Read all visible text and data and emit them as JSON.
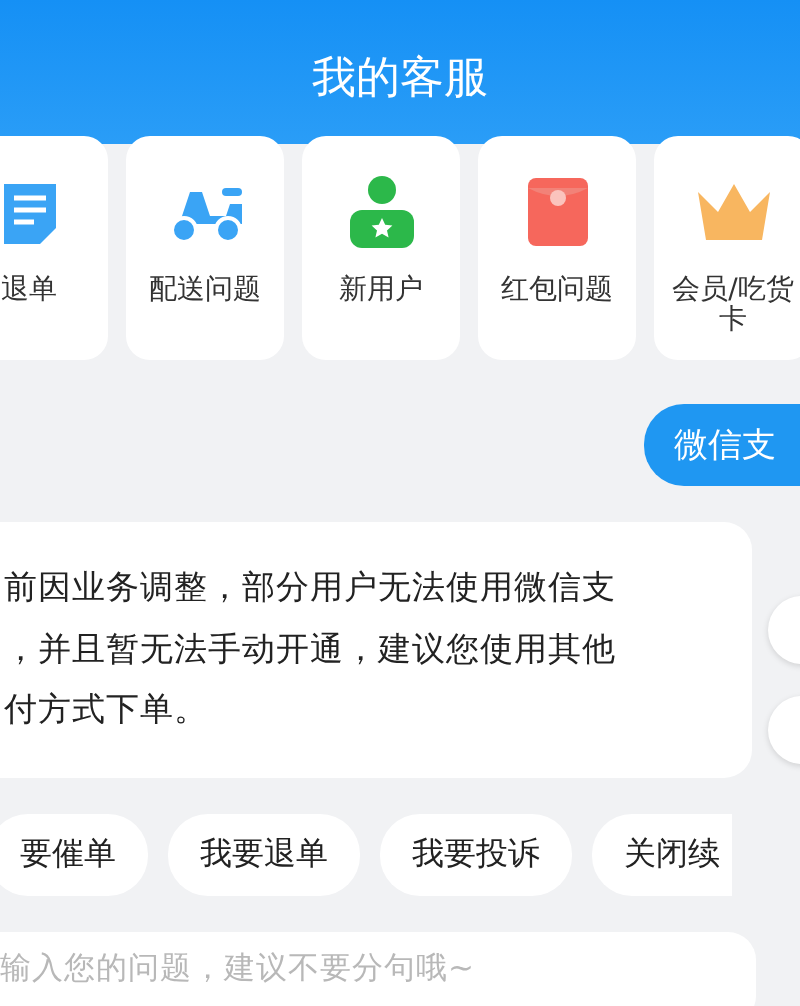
{
  "header": {
    "title": "我的客服"
  },
  "categories": [
    {
      "kind": "document",
      "label": "退单"
    },
    {
      "kind": "scooter",
      "label": "配送问题"
    },
    {
      "kind": "person",
      "label": "新用户"
    },
    {
      "kind": "envelope",
      "label": "红包问题"
    },
    {
      "kind": "crown",
      "label": "会员/吃货卡"
    }
  ],
  "messages": [
    {
      "kind": "user",
      "text": "微信支"
    },
    {
      "kind": "bot",
      "text": "前因业务调整，部分用户无法使用微信支，并且暂无法手动开通，建议您使用其他付方式下单。"
    }
  ],
  "quick_replies": [
    "要催单",
    "我要退单",
    "我要投诉",
    "关闭续"
  ],
  "input": {
    "placeholder": "输入您的问题，建议不要分句哦~"
  }
}
